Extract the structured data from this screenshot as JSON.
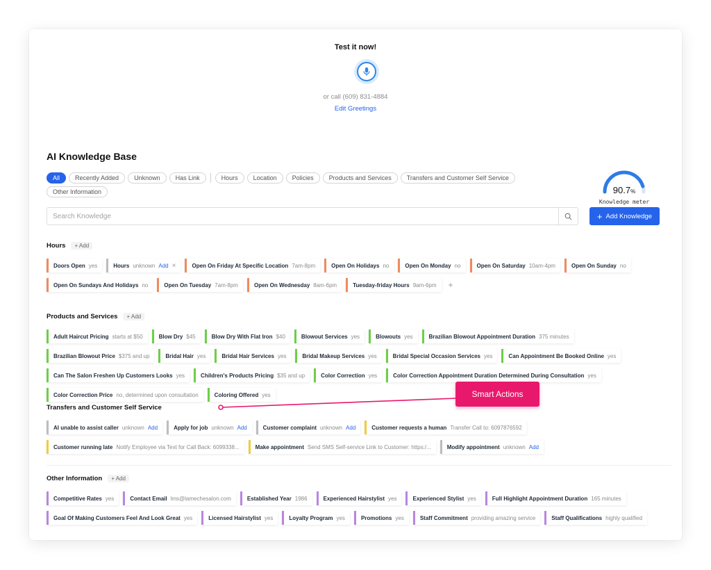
{
  "test": {
    "title": "Test it now!",
    "call_text": "or call (609) 831-4884",
    "edit_link": "Edit Greetings"
  },
  "kb": {
    "title": "AI Knowledge Base",
    "filters": [
      "All",
      "Recently Added",
      "Unknown",
      "Has Link",
      "Hours",
      "Location",
      "Policies",
      "Products and Services",
      "Transfers and Customer Self Service",
      "Other Information"
    ],
    "active_filter": "All",
    "search_placeholder": "Search Knowledge",
    "meter_value": "90.7",
    "meter_unit": "%",
    "meter_fraction": 0.907,
    "meter_label": "Knowledge meter",
    "add_button": "Add Knowledge"
  },
  "callout": {
    "label": "Smart Actions"
  },
  "sections": {
    "hours": {
      "title": "Hours",
      "add_label": "+ Add",
      "chips": [
        {
          "name": "Doors Open",
          "value": "yes"
        },
        {
          "name": "Hours",
          "value": "unknown",
          "add": "Add",
          "remove": true
        },
        {
          "name": "Open On Friday At Specific Location",
          "value": "7am-8pm"
        },
        {
          "name": "Open On Holidays",
          "value": "no"
        },
        {
          "name": "Open On Monday",
          "value": "no"
        },
        {
          "name": "Open On Saturday",
          "value": "10am-4pm"
        },
        {
          "name": "Open On Sunday",
          "value": "no"
        },
        {
          "name": "Open On Sundays And Holidays",
          "value": "no"
        },
        {
          "name": "Open On Tuesday",
          "value": "7am-8pm"
        },
        {
          "name": "Open On Wednesday",
          "value": "8am-6pm"
        },
        {
          "name": "Tuesday-friday Hours",
          "value": "9am-6pm"
        }
      ]
    },
    "products": {
      "title": "Products and Services",
      "add_label": "+ Add",
      "chips": [
        {
          "name": "Adult Haircut Pricing",
          "value": "starts at $50"
        },
        {
          "name": "Blow Dry",
          "value": "$45"
        },
        {
          "name": "Blow Dry With Flat Iron",
          "value": "$40"
        },
        {
          "name": "Blowout Services",
          "value": "yes"
        },
        {
          "name": "Blowouts",
          "value": "yes"
        },
        {
          "name": "Brazilian Blowout Appointment Duration",
          "value": "375 minutes"
        },
        {
          "name": "Brazilian Blowout Price",
          "value": "$375 and up"
        },
        {
          "name": "Bridal Hair",
          "value": "yes"
        },
        {
          "name": "Bridal Hair Services",
          "value": "yes"
        },
        {
          "name": "Bridal Makeup Services",
          "value": "yes"
        },
        {
          "name": "Bridal Special Occasion Services",
          "value": "yes"
        },
        {
          "name": "Can Appointment Be Booked Online",
          "value": "yes"
        },
        {
          "name": "Can The Salon Freshen Up Customers Looks",
          "value": "yes"
        },
        {
          "name": "Children's Products Pricing",
          "value": "$35 and up"
        },
        {
          "name": "Color Correction",
          "value": "yes"
        },
        {
          "name": "Color Correction Appointment Duration Determined During Consultation",
          "value": "yes"
        },
        {
          "name": "Color Correction Price",
          "value": "no, determined upon consultation"
        },
        {
          "name": "Coloring Offered",
          "value": "yes"
        }
      ]
    },
    "transfers": {
      "title": "Transfers and Customer Self Service",
      "chips": [
        {
          "name": "AI unable to assist caller",
          "value": "unknown",
          "add": "Add",
          "color": "gray"
        },
        {
          "name": "Apply for job",
          "value": "unknown",
          "add": "Add",
          "color": "gray"
        },
        {
          "name": "Customer complaint",
          "value": "unknown",
          "add": "Add",
          "color": "gray"
        },
        {
          "name": "Customer requests a human",
          "value": "Transfer Call to: 6097876592",
          "color": "yellow"
        },
        {
          "name": "Customer running late",
          "value": "Notify Employee via Text for Call Back: 6099338...",
          "color": "yellow"
        },
        {
          "name": "Make appointment",
          "value": "Send SMS Self-service Link to Customer: https:/...",
          "color": "yellow"
        },
        {
          "name": "Modify appointment",
          "value": "unknown",
          "add": "Add",
          "color": "gray"
        }
      ]
    },
    "other": {
      "title": "Other Information",
      "add_label": "+ Add",
      "chips": [
        {
          "name": "Competitive Rates",
          "value": "yes"
        },
        {
          "name": "Contact Email",
          "value": "lms@lamechesalon.com"
        },
        {
          "name": "Established Year",
          "value": "1986"
        },
        {
          "name": "Experienced Hairstylist",
          "value": "yes"
        },
        {
          "name": "Experienced Stylist",
          "value": "yes"
        },
        {
          "name": "Full Highlight Appointment Duration",
          "value": "165 minutes"
        },
        {
          "name": "Goal Of Making Customers Feel And Look Great",
          "value": "yes"
        },
        {
          "name": "Licensed Hairstylist",
          "value": "yes"
        },
        {
          "name": "Loyalty Program",
          "value": "yes"
        },
        {
          "name": "Promotions",
          "value": "yes"
        },
        {
          "name": "Staff Commitment",
          "value": "providing amazing service"
        },
        {
          "name": "Staff Qualifications",
          "value": "highly qualified"
        }
      ]
    }
  },
  "colors": {
    "accent": "#2563eb",
    "hours": "#f08a5d",
    "products": "#6ccf48",
    "other": "#b886e0",
    "unknown": "#bdbdbd",
    "action": "#f2cc3b",
    "callout": "#e8196c"
  },
  "icons": {
    "mic": "microphone-icon",
    "search": "search-icon",
    "add": "plus-icon",
    "remove": "close-icon"
  }
}
